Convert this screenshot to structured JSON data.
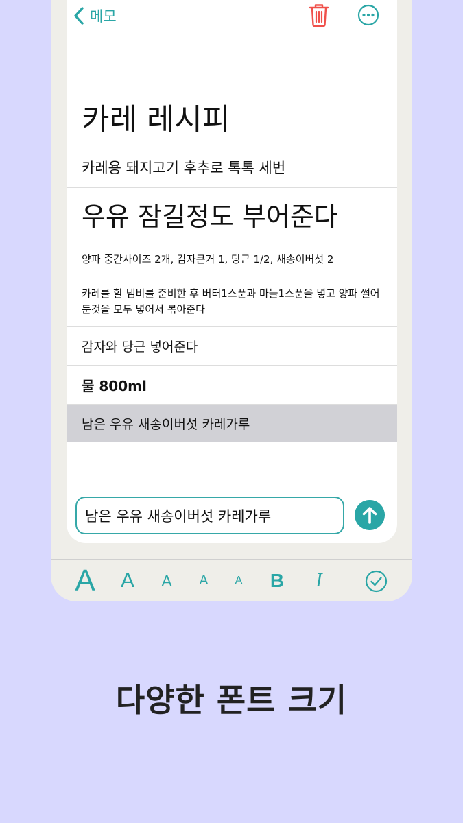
{
  "nav": {
    "back_label": "메모"
  },
  "memo": {
    "rows": [
      "카레 레시피",
      "카레용 돼지고기 후추로 톡톡 세번",
      "우유 잠길정도 부어준다",
      "양파 중간사이즈 2개, 감자큰거 1, 당근 1/2, 새송이버섯 2",
      "카레를 할 냄비를 준비한 후 버터1스푼과 마늘1스푼을 넣고 양파 썰어둔것을 모두 넣어서 볶아준다",
      "감자와 당근 넣어준다",
      "물 800ml",
      "남은 우유 새송이버섯 카레가루"
    ],
    "selected_index": 7
  },
  "input": {
    "value": "남은 우유 새송이버섯 카레가루"
  },
  "toolbar": {
    "font_size_glyph": "A",
    "bold_glyph": "B",
    "italic_glyph": "I"
  },
  "caption": "다양한 폰트 크기",
  "colors": {
    "accent": "#2aa6a6",
    "delete": "#f0504a",
    "background": "#d8d8fe",
    "selected_row": "#d1d1d6"
  },
  "icons": {
    "back": "chevron-left-icon",
    "delete": "trash-icon",
    "more": "more-circle-icon",
    "send": "arrow-up-circle-icon",
    "done": "checkmark-circle-icon"
  }
}
